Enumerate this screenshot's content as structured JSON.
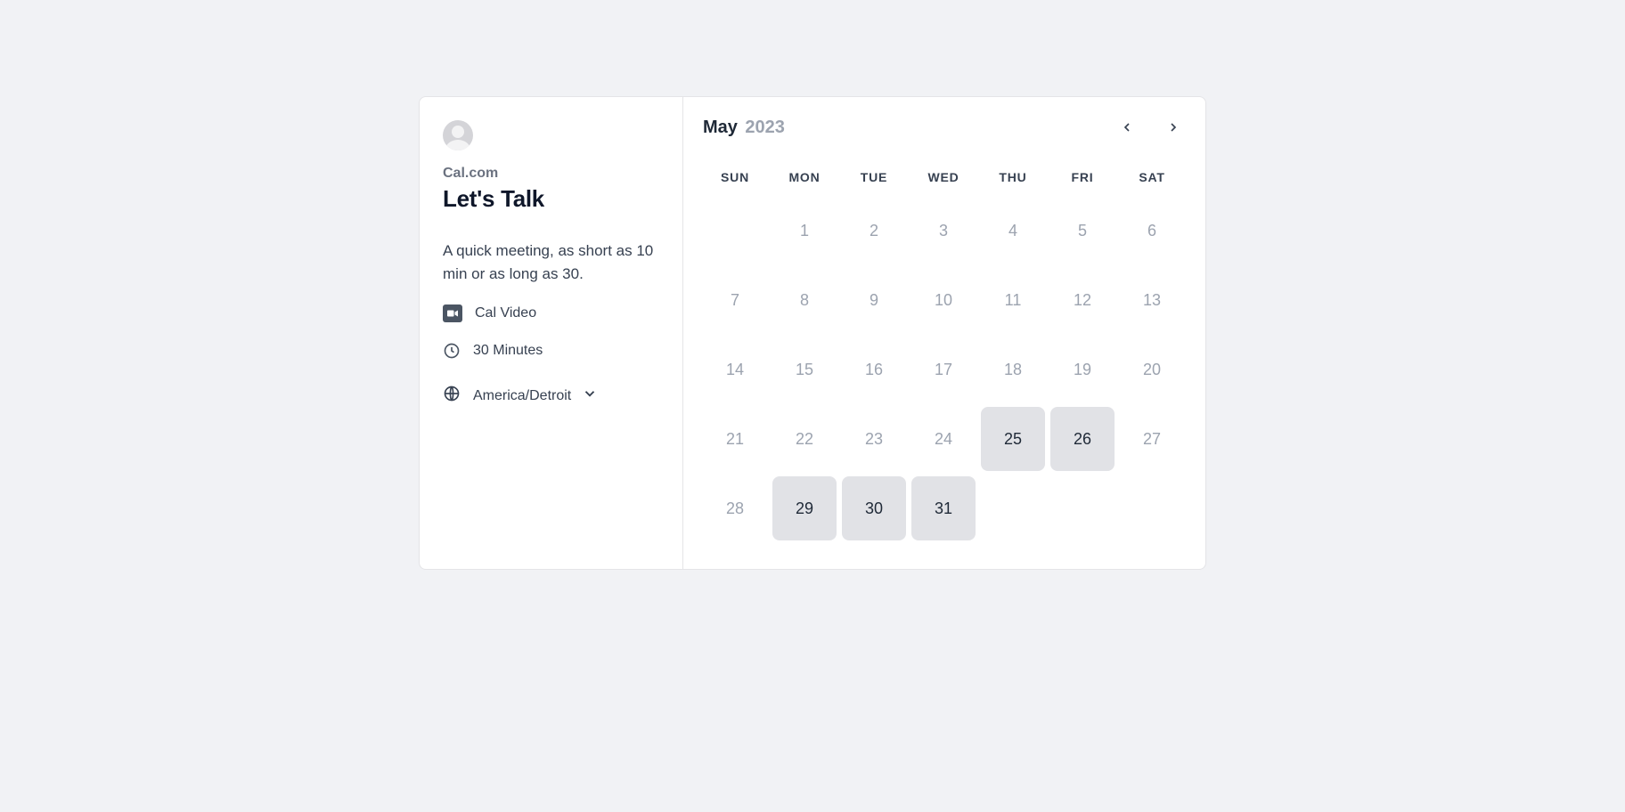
{
  "org": "Cal.com",
  "title": "Let's Talk",
  "description": "A quick meeting, as short as 10 min or as long as 30.",
  "location": "Cal Video",
  "duration": "30 Minutes",
  "timezone": "America/Detroit",
  "month": "May",
  "year": "2023",
  "weekdays": [
    "SUN",
    "MON",
    "TUE",
    "WED",
    "THU",
    "FRI",
    "SAT"
  ],
  "calendar": [
    [
      {
        "d": "",
        "a": false
      },
      {
        "d": "1",
        "a": false
      },
      {
        "d": "2",
        "a": false
      },
      {
        "d": "3",
        "a": false
      },
      {
        "d": "4",
        "a": false
      },
      {
        "d": "5",
        "a": false
      },
      {
        "d": "6",
        "a": false
      }
    ],
    [
      {
        "d": "7",
        "a": false
      },
      {
        "d": "8",
        "a": false
      },
      {
        "d": "9",
        "a": false
      },
      {
        "d": "10",
        "a": false
      },
      {
        "d": "11",
        "a": false
      },
      {
        "d": "12",
        "a": false
      },
      {
        "d": "13",
        "a": false
      }
    ],
    [
      {
        "d": "14",
        "a": false
      },
      {
        "d": "15",
        "a": false
      },
      {
        "d": "16",
        "a": false
      },
      {
        "d": "17",
        "a": false
      },
      {
        "d": "18",
        "a": false
      },
      {
        "d": "19",
        "a": false
      },
      {
        "d": "20",
        "a": false
      }
    ],
    [
      {
        "d": "21",
        "a": false
      },
      {
        "d": "22",
        "a": false
      },
      {
        "d": "23",
        "a": false
      },
      {
        "d": "24",
        "a": false
      },
      {
        "d": "25",
        "a": true
      },
      {
        "d": "26",
        "a": true
      },
      {
        "d": "27",
        "a": false
      }
    ],
    [
      {
        "d": "28",
        "a": false
      },
      {
        "d": "29",
        "a": true
      },
      {
        "d": "30",
        "a": true
      },
      {
        "d": "31",
        "a": true
      },
      {
        "d": "",
        "a": false
      },
      {
        "d": "",
        "a": false
      },
      {
        "d": "",
        "a": false
      }
    ]
  ]
}
